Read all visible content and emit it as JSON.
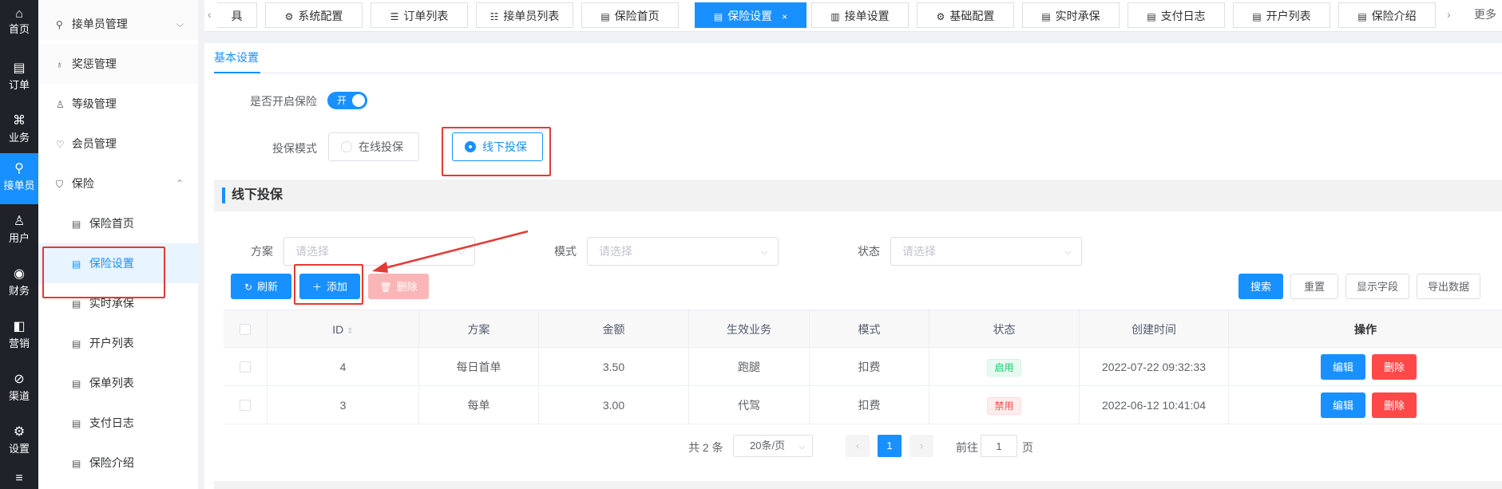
{
  "rail": {
    "items": [
      {
        "icon": "home-icon",
        "glyph": "⌂",
        "label": "首页"
      },
      {
        "icon": "order-icon",
        "glyph": "▤",
        "label": "订单"
      },
      {
        "icon": "business-icon",
        "glyph": "⌘",
        "label": "业务"
      },
      {
        "icon": "rider-icon",
        "glyph": "⚲",
        "label": "接单员"
      },
      {
        "icon": "user-icon",
        "glyph": "♙",
        "label": "用户"
      },
      {
        "icon": "finance-icon",
        "glyph": "◉",
        "label": "财务"
      },
      {
        "icon": "marketing-icon",
        "glyph": "◧",
        "label": "营销"
      },
      {
        "icon": "channel-icon",
        "glyph": "⊘",
        "label": "渠道"
      },
      {
        "icon": "settings-icon",
        "glyph": "⚙",
        "label": "设置"
      },
      {
        "icon": "sliders-icon",
        "glyph": "≡",
        "label": ""
      }
    ]
  },
  "sidebar": {
    "groups": [
      {
        "label": "接单员管理",
        "glyph": "⚲"
      },
      {
        "label": "奖惩管理",
        "glyph": "♁"
      },
      {
        "label": "等级管理",
        "glyph": "♙"
      },
      {
        "label": "会员管理",
        "glyph": "♡"
      },
      {
        "label": "保险",
        "glyph": "⛉"
      }
    ],
    "sub_items": [
      {
        "label": "保险首页"
      },
      {
        "label": "保险设置"
      },
      {
        "label": "实时承保"
      },
      {
        "label": "开户列表"
      },
      {
        "label": "保单列表"
      },
      {
        "label": "支付日志"
      },
      {
        "label": "保险介绍"
      }
    ]
  },
  "tabs": {
    "partial_left": "具",
    "items": [
      {
        "label": "系统配置",
        "glyph": "⚙"
      },
      {
        "label": "订单列表",
        "glyph": "☰"
      },
      {
        "label": "接单员列表",
        "glyph": "☷"
      },
      {
        "label": "保险首页",
        "glyph": "▤"
      },
      {
        "label": "保险设置",
        "glyph": "▤",
        "close": "×"
      },
      {
        "label": "接单设置",
        "glyph": "▥"
      },
      {
        "label": "基础配置",
        "glyph": "⚙"
      },
      {
        "label": "实时承保",
        "glyph": "▤"
      },
      {
        "label": "支付日志",
        "glyph": "▤"
      },
      {
        "label": "开户列表",
        "glyph": "▤"
      },
      {
        "label": "保险介绍",
        "glyph": "▤"
      }
    ],
    "prev": "‹",
    "next": "›",
    "more": "更多"
  },
  "settings": {
    "subtab": "基本设置",
    "enable_label": "是否开启保险",
    "switch_text": "开",
    "mode_label": "投保模式",
    "mode_online": "在线投保",
    "mode_offline": "线下投保"
  },
  "section": {
    "title": "线下投保"
  },
  "filters": {
    "plan_label": "方案",
    "plan_placeholder": "请选择",
    "mode_label": "模式",
    "mode_placeholder": "请选择",
    "status_label": "状态",
    "status_placeholder": "请选择"
  },
  "toolbar": {
    "refresh": "刷新",
    "add": "添加",
    "delete": "删除",
    "search": "搜索",
    "reset": "重置",
    "show_fields": "显示字段",
    "export": "导出数据"
  },
  "table": {
    "columns": [
      "ID",
      "方案",
      "金额",
      "生效业务",
      "模式",
      "状态",
      "创建时间",
      "操作"
    ],
    "rows": [
      {
        "id": "4",
        "plan": "每日首单",
        "amount": "3.50",
        "business": "跑腿",
        "mode": "扣费",
        "status": "启用",
        "created": "2022-07-22 09:32:33",
        "edit": "编辑",
        "delete": "删除"
      },
      {
        "id": "3",
        "plan": "每单",
        "amount": "3.00",
        "business": "代驾",
        "mode": "扣费",
        "status": "禁用",
        "created": "2022-06-12 10:41:04",
        "edit": "编辑",
        "delete": "删除"
      }
    ]
  },
  "pagination": {
    "total": "共 2 条",
    "page_size": "20条/页",
    "current": "1",
    "goto_label": "前往",
    "goto_value": "1",
    "page_suffix": "页"
  },
  "colors": {
    "primary": "#1890ff",
    "danger": "#ff4949",
    "success": "#13ce66",
    "rail": "#1f2329",
    "annotation": "#e53935"
  }
}
